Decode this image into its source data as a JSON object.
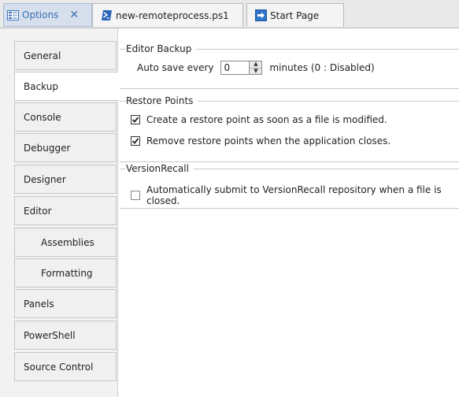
{
  "tabs": {
    "active": {
      "label": "Options",
      "close": "✕"
    },
    "remote": {
      "label": "new-remoteprocess.ps1"
    },
    "start": {
      "label": "Start Page"
    }
  },
  "nav": {
    "items": [
      {
        "label": "General"
      },
      {
        "label": "Backup"
      },
      {
        "label": "Console"
      },
      {
        "label": "Debugger"
      },
      {
        "label": "Designer"
      },
      {
        "label": "Editor"
      },
      {
        "label": "Assemblies"
      },
      {
        "label": "Formatting"
      },
      {
        "label": "Panels"
      },
      {
        "label": "PowerShell"
      },
      {
        "label": "Source Control"
      }
    ],
    "selected": "Backup"
  },
  "editor_backup": {
    "title": "Editor Backup",
    "auto_save_label": "Auto save every",
    "auto_save_value": "0",
    "minutes_label": "minutes (0 : Disabled)"
  },
  "restore_points": {
    "title": "Restore Points",
    "create_label": "Create a restore point as soon as a file is modified.",
    "create_checked": true,
    "remove_label": "Remove restore points when the application closes.",
    "remove_checked": true
  },
  "version_recall": {
    "title": "VersionRecall",
    "auto_submit_label": "Automatically submit to VersionRecall repository when a file is closed.",
    "auto_submit_checked": false
  },
  "colors": {
    "active_tab_bg": "#d6dfec",
    "active_tab_text": "#3a6fb4",
    "nav_bg": "#f0f0f0",
    "border": "#c6c6c6"
  },
  "icons": {
    "options_tab": "options-grid-icon",
    "remote_tab": "powershell-file-icon",
    "start_tab": "arrow-page-icon"
  }
}
